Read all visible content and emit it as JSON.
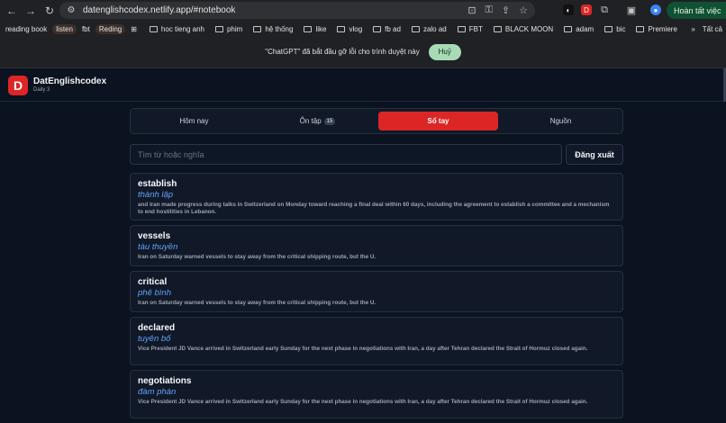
{
  "browser": {
    "url": "datenglishcodex.netlify.app/#notebook",
    "update_label": "Hoàn tất việc",
    "ext1": "D",
    "bookmarks": [
      "reading book",
      "listen",
      "fbt",
      "Reding",
      "hoc tieng anh",
      "phim",
      "hệ thống",
      "like",
      "vlog",
      "fb ad",
      "zalo ad",
      "FBT",
      "BLACK MOON",
      "adam",
      "bic",
      "Premiere"
    ],
    "all_bookmarks": "Tất cả",
    "debug_text": "\"ChatGPT\" đã bắt đầu gỡ lỗi cho trình duyệt này",
    "cancel_label": "Huỷ"
  },
  "app": {
    "logo": "D",
    "brand": "DatEnglishcodex",
    "subtitle": "Daily 3",
    "tabs": [
      {
        "label": "Hôm nay"
      },
      {
        "label": "Ôn tập",
        "badge": "15"
      },
      {
        "label": "Sổ tay"
      },
      {
        "label": "Nguồn"
      }
    ],
    "active_tab": 2,
    "search_placeholder": "Tìm từ hoặc nghĩa",
    "logout_label": "Đăng xuất",
    "entries": [
      {
        "word": "establish",
        "meaning": "thành lập",
        "example": "and Iran made progress during talks in Switzerland on Monday toward reaching a final deal within 60 days, including the agreement to establish a committee and a mechanism to end hostilities in Lebanon."
      },
      {
        "word": "vessels",
        "meaning": "tàu thuyền",
        "example": "Iran on Saturday warned vessels to stay away from the critical shipping route, but the U."
      },
      {
        "word": "critical",
        "meaning": "phê bình",
        "example": "Iran on Saturday warned vessels to stay away from the critical shipping route, but the U."
      },
      {
        "word": "declared",
        "meaning": "tuyên bố",
        "example": "Vice President JD Vance arrived in Switzerland early Sunday for the next phase in negotiations with Iran, a day after Tehran declared the Strait of Hormuz closed again."
      },
      {
        "word": "negotiations",
        "meaning": "đàm phán",
        "example": "Vice President JD Vance arrived in Switzerland early Sunday for the next phase in negotiations with Iran, a day after Tehran declared the Strait of Hormuz closed again."
      }
    ]
  }
}
